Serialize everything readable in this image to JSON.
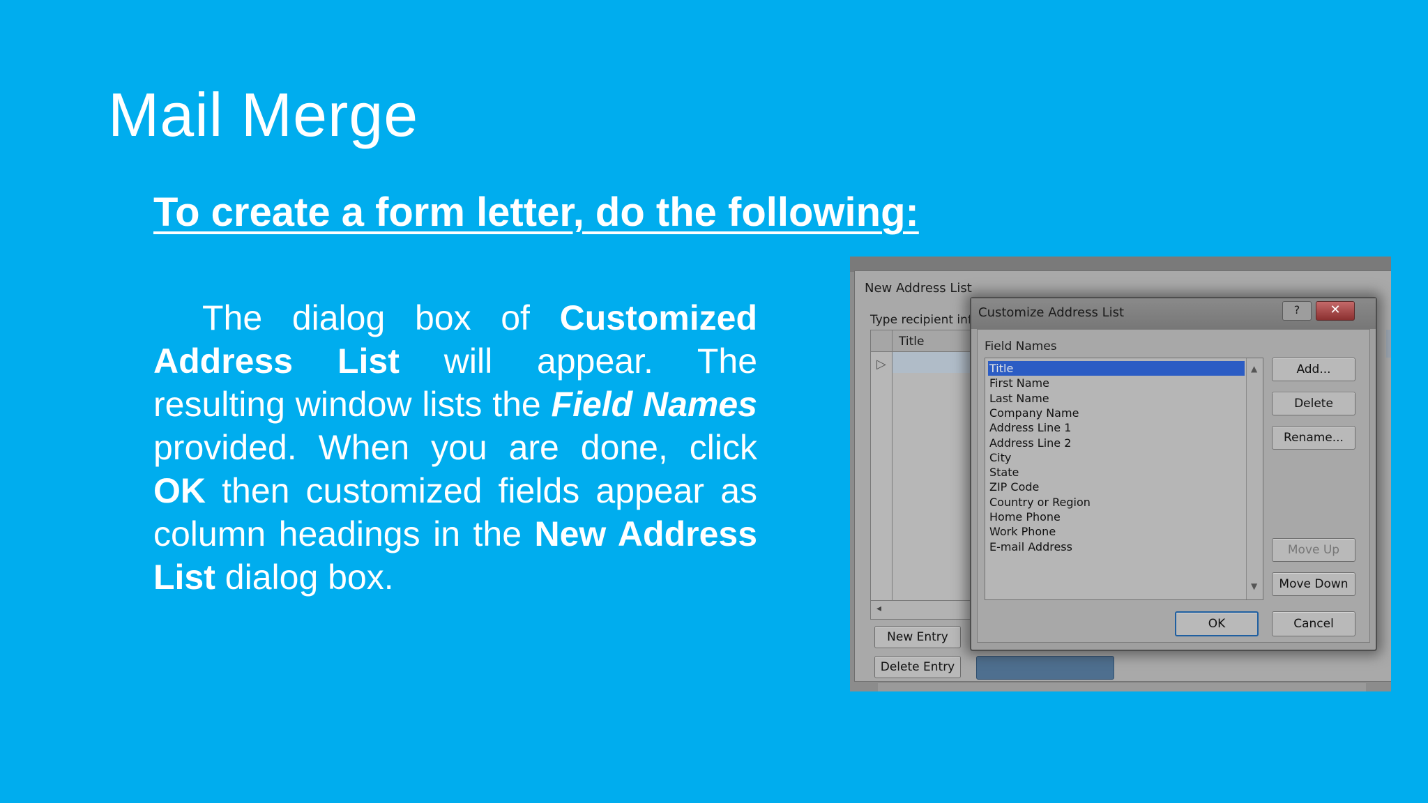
{
  "slide": {
    "title": "Mail Merge",
    "subtitle": "To create a form letter, do the following:",
    "body": {
      "t1": "The dialog box of ",
      "t2": "Customized Address List",
      "t3": " will appear. The resulting window lists the ",
      "t4": "Field Names",
      "t5": " provided.  When you are done, click ",
      "t6": "OK",
      "t7": " then customized fields appear as column headings in the ",
      "t8": "New Address List",
      "t9": " dialog box."
    }
  },
  "new_address_list": {
    "title": "New Address List",
    "type_label": "Type recipient info",
    "column_header": "Title",
    "new_entry_label": "New Entry",
    "delete_entry_label": "Delete Entry"
  },
  "customize_dialog": {
    "title": "Customize Address List",
    "help_label": "?",
    "close_label": "✕",
    "field_names_label": "Field Names",
    "fields": [
      "Title",
      "First Name",
      "Last Name",
      "Company Name",
      "Address Line 1",
      "Address Line 2",
      "City",
      "State",
      "ZIP Code",
      "Country or Region",
      "Home Phone",
      "Work Phone",
      "E-mail Address"
    ],
    "selected_index": 0,
    "buttons": {
      "add": "Add...",
      "delete": "Delete",
      "rename": "Rename...",
      "move_up": "Move Up",
      "move_down": "Move Down",
      "ok": "OK",
      "cancel": "Cancel"
    }
  }
}
